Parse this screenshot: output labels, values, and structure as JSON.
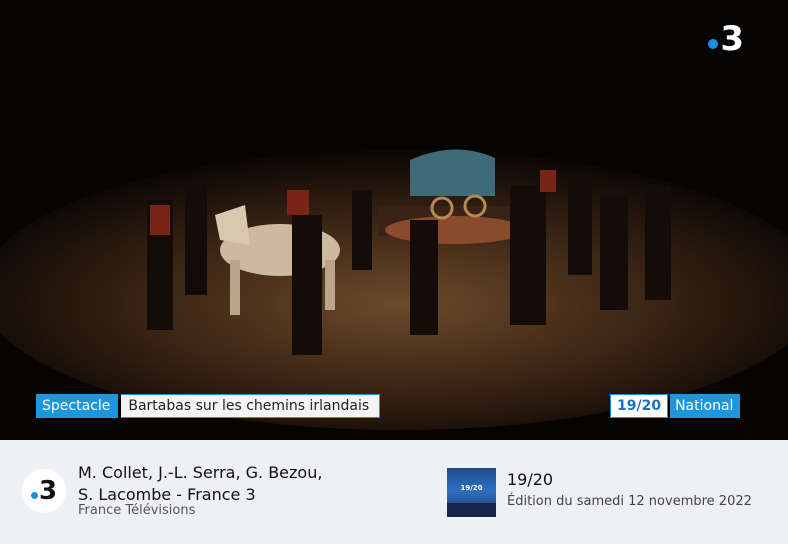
{
  "video": {
    "channel_logo": {
      "dot": "",
      "number": "3"
    },
    "lower_third": {
      "tag": "Spectacle",
      "title": "Bartabas sur les chemins irlandais",
      "program": "19/20",
      "region": "National"
    }
  },
  "info": {
    "channel_badge": "3",
    "credits_line1": "M. Collet, J.-L. Serra, G. Bezou,",
    "credits_line2": "S. Lacombe - France 3",
    "publisher": "France Télévisions",
    "thumbnail_label": "19/20",
    "show_title": "19/20",
    "edition": "Édition du samedi 12 novembre 2022"
  },
  "colors": {
    "accent": "#1e96dc",
    "background": "#eef0f3"
  }
}
